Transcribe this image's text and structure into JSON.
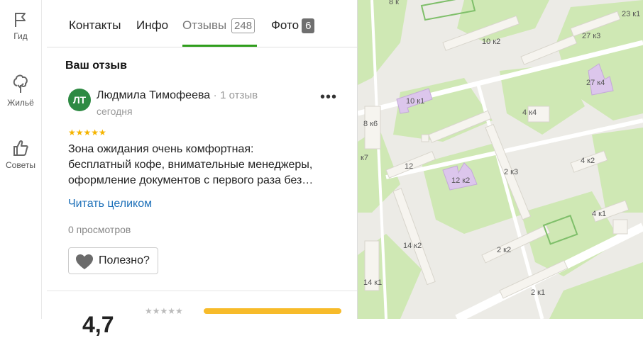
{
  "sidebar": {
    "items": [
      {
        "label": "Гид",
        "icon": "flag-icon"
      },
      {
        "label": "Жильё",
        "icon": "tree-icon"
      },
      {
        "label": "Советы",
        "icon": "thumb-up-icon"
      }
    ]
  },
  "tabs": [
    {
      "label": "Контакты"
    },
    {
      "label": "Инфо"
    },
    {
      "label": "Отзывы",
      "count": "248",
      "active": true
    },
    {
      "label": "Фото",
      "count": "6"
    }
  ],
  "review_section": {
    "title": "Ваш отзыв",
    "review": {
      "avatar_initials": "ЛТ",
      "author": "Людмила Тимофеева",
      "separator": "·",
      "reviews_count": "1 отзыв",
      "date": "сегодня",
      "rating": 5,
      "text_lines": [
        "Зона ожидания очень комфортная:",
        "бесплатный кофе, внимательные менеджеры,",
        "оформление документов с первого раза без…"
      ],
      "read_more": "Читать целиком",
      "views": "0 просмотров",
      "useful_label": "Полезно?"
    }
  },
  "summary": {
    "rating_partial": "4,7"
  },
  "map": {
    "labels": [
      "8 к",
      "23 к1",
      "10 к2",
      "27 к3",
      "27 к4",
      "10 к1",
      "8 к6",
      "4 к4",
      "к7",
      "12",
      "12 к2",
      "2 к3",
      "4 к2",
      "4 к1",
      "14 к2",
      "2 к2",
      "14 к1",
      "2 к1"
    ]
  },
  "colors": {
    "accent_green": "#2f9e1c",
    "link_blue": "#1c6fb8",
    "avatar_green": "#2e8a43",
    "star_yellow": "#f5b400",
    "map_green": "#cfe8b4",
    "building_purple": "#dcc6ec"
  }
}
